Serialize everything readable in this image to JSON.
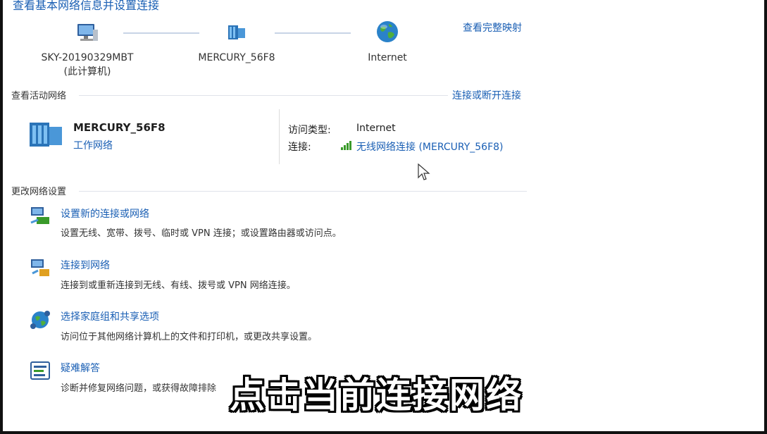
{
  "header": {
    "title": "查看基本网络信息并设置连接",
    "full_map_link": "查看完整映射"
  },
  "network_map": {
    "computer": {
      "name": "SKY-20190329MBT",
      "sub": "(此计算机)",
      "icon": "computer-icon"
    },
    "router": {
      "name": "MERCURY_56F8",
      "icon": "router-icon"
    },
    "internet": {
      "name": "Internet",
      "icon": "globe-icon"
    }
  },
  "active_networks": {
    "heading": "查看活动网络",
    "connect_link": "连接或断开连接",
    "network_name": "MERCURY_56F8",
    "network_type": "工作网络",
    "access_type_label": "访问类型:",
    "access_type_value": "Internet",
    "connection_label": "连接:",
    "connection_value": "无线网络连接 (MERCURY_56F8)",
    "signal_icon": "wifi-signal-icon"
  },
  "change_settings": {
    "heading": "更改网络设置",
    "tasks": [
      {
        "title": "设置新的连接或网络",
        "desc": "设置无线、宽带、拨号、临时或 VPN 连接；或设置路由器或访问点。",
        "icon": "new-connection-icon"
      },
      {
        "title": "连接到网络",
        "desc": "连接到或重新连接到无线、有线、拨号或 VPN 网络连接。",
        "icon": "connect-network-icon"
      },
      {
        "title": "选择家庭组和共享选项",
        "desc": "访问位于其他网络计算机上的文件和打印机，或更改共享设置。",
        "icon": "homegroup-icon"
      },
      {
        "title": "疑难解答",
        "desc": "诊断并修复网络问题，或获得故障排除",
        "icon": "troubleshoot-icon"
      }
    ]
  },
  "overlay": {
    "subtitle": "点击当前连接网络"
  },
  "colors": {
    "link": "#1a5fb4",
    "connector": "#c8d4e6"
  }
}
